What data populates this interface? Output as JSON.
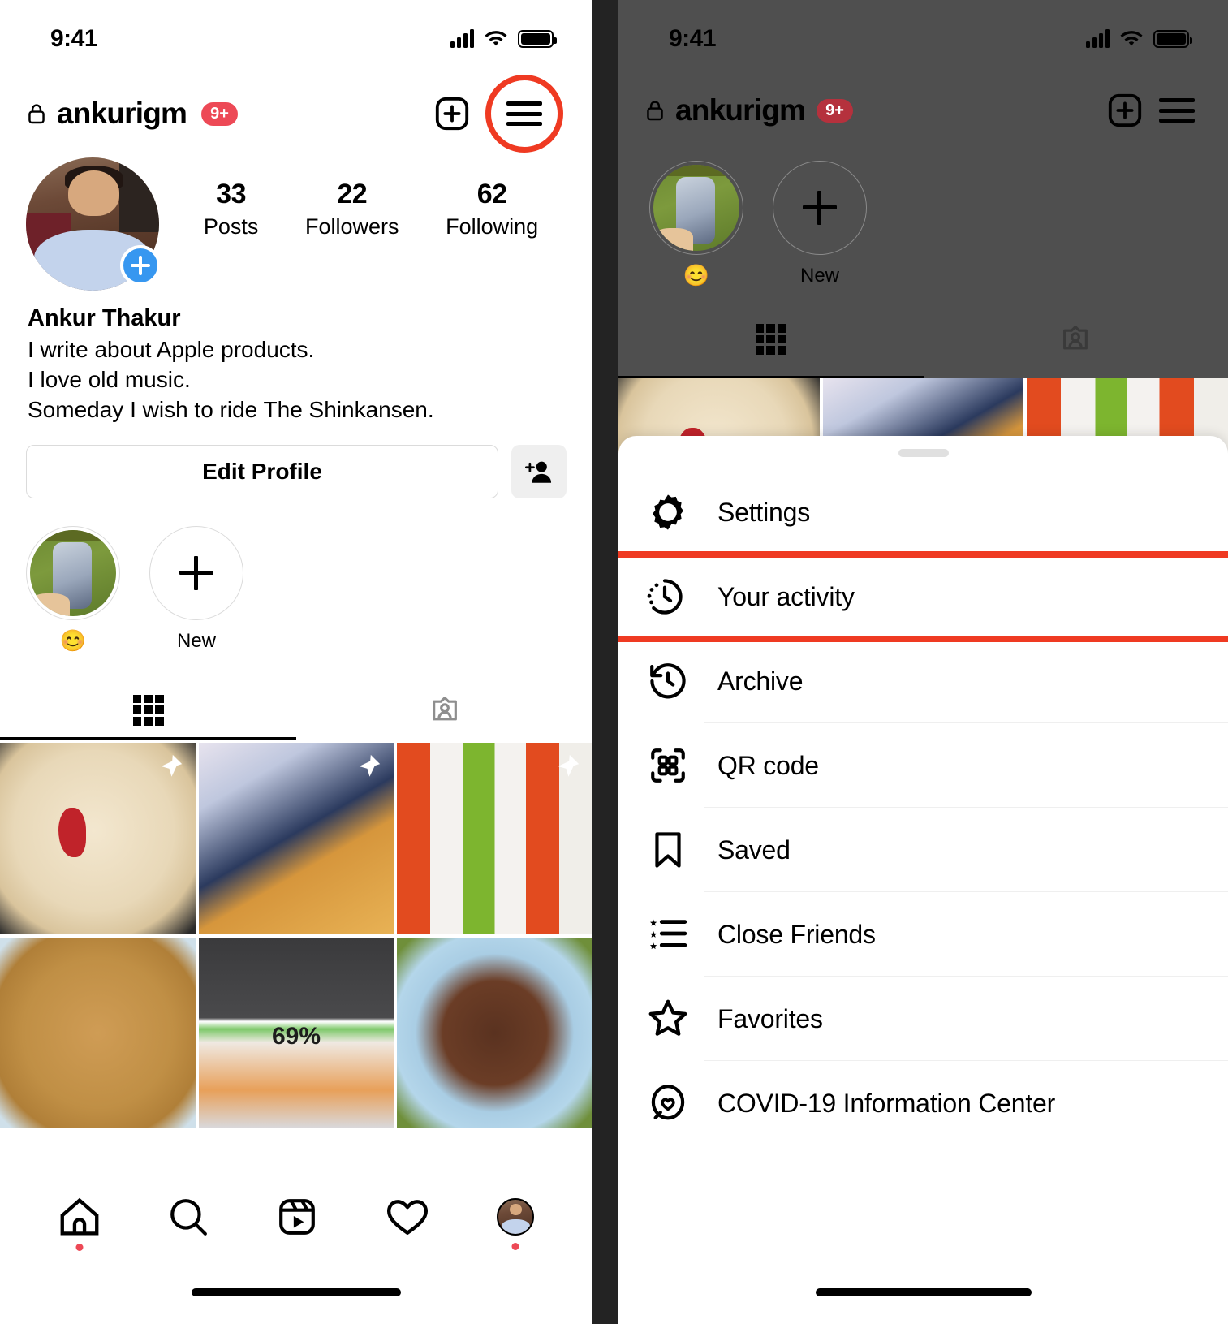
{
  "left_phone": {
    "status_bar": {
      "time": "9:41",
      "signal_icon": "cellular-bars-icon",
      "wifi_icon": "wifi-icon",
      "battery_icon": "battery-icon"
    },
    "profile_header": {
      "lock_icon": "lock-icon",
      "username": "ankurigm",
      "notification_badge": "9+",
      "add_icon": "plus-square-icon",
      "menu_icon": "hamburger-menu-icon",
      "highlight_color": "#ef3a22"
    },
    "stats": [
      {
        "number": "33",
        "label": "Posts"
      },
      {
        "number": "22",
        "label": "Followers"
      },
      {
        "number": "62",
        "label": "Following"
      }
    ],
    "avatar": {
      "name": "profile-avatar",
      "add_story_badge": "plus-circle-icon",
      "badge_color": "#3797f0"
    },
    "bio": {
      "display_name": "Ankur Thakur",
      "line1": "I write about Apple products.",
      "line2": "I love old music.",
      "line3": "Someday I wish to ride The Shinkansen."
    },
    "actions": {
      "edit_profile_label": "Edit Profile",
      "add_person_icon": "person-add-icon"
    },
    "highlights": [
      {
        "label": "😊",
        "type": "story"
      },
      {
        "label": "New",
        "type": "new"
      }
    ],
    "tabs": [
      {
        "icon": "grid-icon",
        "active": true
      },
      {
        "icon": "tagged-person-icon",
        "active": false
      }
    ],
    "photo_grid": [
      {
        "name": "post-cake-white-drizzle",
        "pinned": true
      },
      {
        "name": "post-pizza-slice",
        "pinned": true
      },
      {
        "name": "post-pringles-cans",
        "pinned": true
      },
      {
        "name": "post-cashew-cake",
        "pinned": false
      },
      {
        "name": "post-battery-widget-screenshot",
        "pinned": false,
        "label": "69%"
      },
      {
        "name": "post-chocolate-cashew-tart",
        "pinned": false
      }
    ],
    "bottom_nav": [
      {
        "icon": "home-icon",
        "dot": true
      },
      {
        "icon": "search-icon",
        "dot": false
      },
      {
        "icon": "reels-icon",
        "dot": false
      },
      {
        "icon": "heart-icon",
        "dot": false
      },
      {
        "icon": "profile-avatar-icon",
        "dot": true
      }
    ]
  },
  "right_phone": {
    "dim_overlay_color": "#4f4f4f",
    "status_bar": {
      "time": "9:41"
    },
    "profile_header": {
      "lock_icon": "lock-icon",
      "username": "ankurigm",
      "notification_badge": "9+",
      "add_icon": "plus-square-icon",
      "menu_icon": "hamburger-menu-icon"
    },
    "highlights": [
      {
        "label": "😊"
      },
      {
        "label": "New"
      }
    ],
    "sheet": {
      "grabber": "drag-handle",
      "menu_items": [
        {
          "icon": "gear-icon",
          "label": "Settings",
          "highlighted": false,
          "divider": false
        },
        {
          "icon": "your-activity-clock-icon",
          "label": "Your activity",
          "highlighted": true,
          "divider": false
        },
        {
          "icon": "archive-clock-icon",
          "label": "Archive",
          "highlighted": false,
          "divider": true
        },
        {
          "icon": "qr-code-icon",
          "label": "QR code",
          "highlighted": false,
          "divider": true
        },
        {
          "icon": "bookmark-icon",
          "label": "Saved",
          "highlighted": false,
          "divider": true
        },
        {
          "icon": "close-friends-list-icon",
          "label": "Close Friends",
          "highlighted": false,
          "divider": true
        },
        {
          "icon": "star-icon",
          "label": "Favorites",
          "highlighted": false,
          "divider": true
        },
        {
          "icon": "covid-info-icon",
          "label": "COVID-19 Information Center",
          "highlighted": false,
          "divider": true
        }
      ],
      "highlight_color": "#ef3a22"
    }
  }
}
